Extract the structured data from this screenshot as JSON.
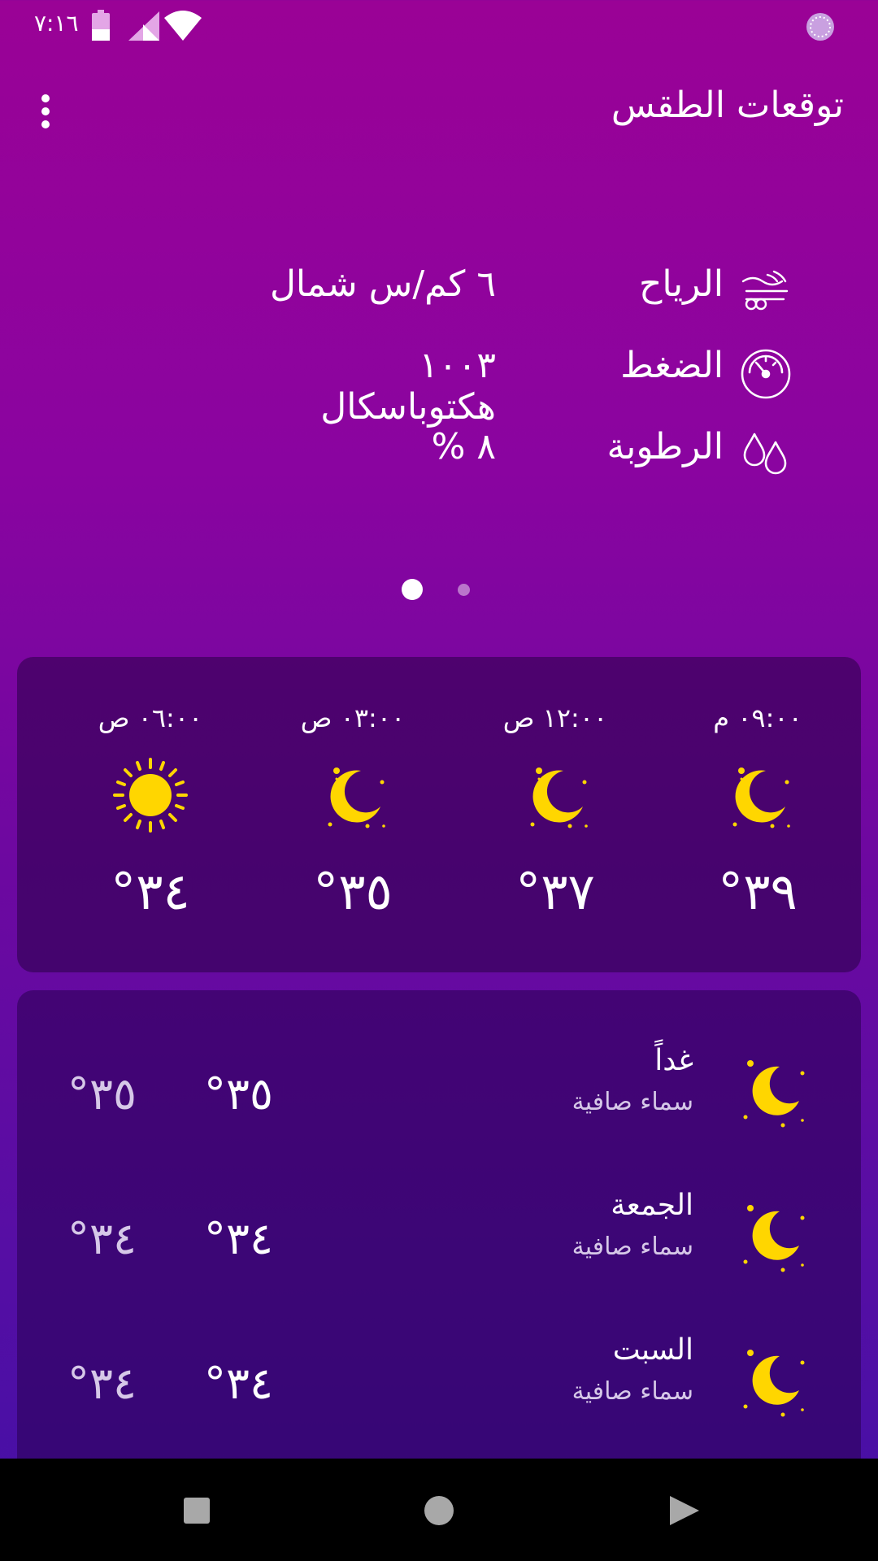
{
  "status_bar": {
    "time": "٧:١٦",
    "icons": [
      "battery-icon",
      "signal-icon",
      "wifi-icon",
      "sync-icon"
    ]
  },
  "app_bar": {
    "title": "توقعات الطقس",
    "menu_icon": "more-vert-icon"
  },
  "details": [
    {
      "icon": "wind-icon",
      "label": "الرياح",
      "value": "٦ كم/س شمال"
    },
    {
      "icon": "gauge-icon",
      "label": "الضغط",
      "value": "١٠٠٣ هكتوباسكال"
    },
    {
      "icon": "humidity-icon",
      "label": "الرطوبة",
      "value": "٨ %"
    }
  ],
  "pager": {
    "pages": 2,
    "active": 0
  },
  "hourly": [
    {
      "time": "٠٦:٠٠ ص",
      "icon": "sun-icon",
      "temp": "٣٤°"
    },
    {
      "time": "٠٣:٠٠ ص",
      "icon": "moon-icon",
      "temp": "٣٥°"
    },
    {
      "time": "١٢:٠٠ ص",
      "icon": "moon-icon",
      "temp": "٣٧°"
    },
    {
      "time": "٠٩:٠٠ م",
      "icon": "moon-icon",
      "temp": "٣٩°"
    }
  ],
  "daily": [
    {
      "day": "غداً",
      "desc": "سماء صافية",
      "icon": "moon-icon",
      "high": "٣٥°",
      "low": "٣٥°"
    },
    {
      "day": "الجمعة",
      "desc": "سماء صافية",
      "icon": "moon-icon",
      "high": "٣٤°",
      "low": "٣٤°"
    },
    {
      "day": "السبت",
      "desc": "سماء صافية",
      "icon": "moon-icon",
      "high": "٣٤°",
      "low": "٣٤°"
    }
  ],
  "nav_bar": {
    "icons": [
      "recents-icon",
      "home-icon",
      "back-icon"
    ]
  },
  "colors": {
    "accent_yellow": "#FFD600",
    "bg_top": "#9A0296",
    "bg_bottom": "#4310A6"
  }
}
